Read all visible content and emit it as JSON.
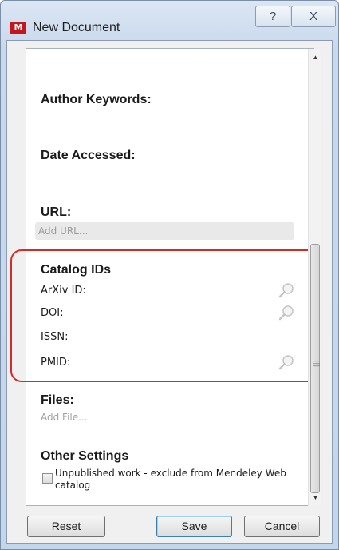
{
  "window": {
    "title": "New Document",
    "logo_text": "M",
    "help_glyph": "?",
    "close_glyph": "X"
  },
  "panel": {
    "author_keywords_label": "Author Keywords:",
    "date_accessed_label": "Date Accessed:",
    "url_label": "URL:",
    "url_placeholder": "Add URL...",
    "catalog_ids_heading": "Catalog IDs",
    "catalog_fields": [
      {
        "label": "ArXiv ID:",
        "has_lookup": true
      },
      {
        "label": "DOI:",
        "has_lookup": true
      },
      {
        "label": "ISSN:",
        "has_lookup": false
      },
      {
        "label": "PMID:",
        "has_lookup": true
      }
    ],
    "files_label": "Files:",
    "add_file_label": "Add File...",
    "other_settings_heading": "Other Settings",
    "unpublished_label": "Unpublished work - exclude from Mendeley Web catalog",
    "unpublished_checked": false
  },
  "buttons": {
    "reset": "Reset",
    "save": "Save",
    "cancel": "Cancel"
  },
  "colors": {
    "highlight": "#d42a2a",
    "logo": "#c4161c"
  }
}
